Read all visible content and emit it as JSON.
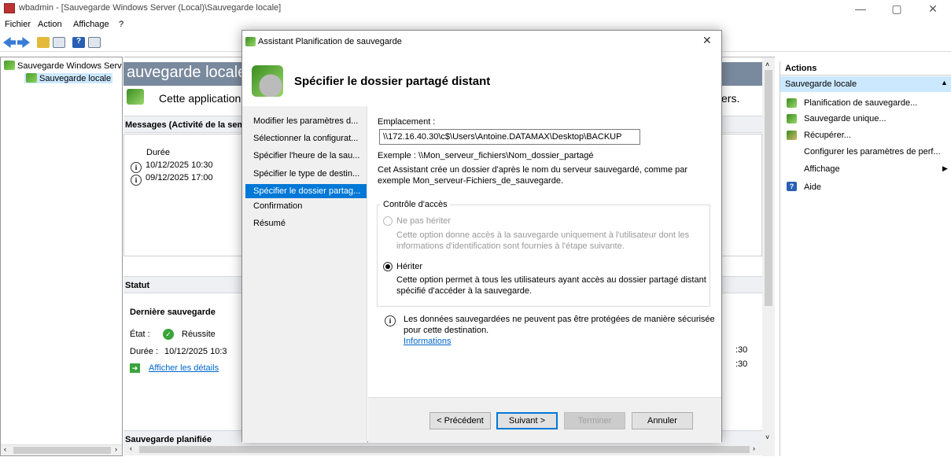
{
  "window": {
    "title": "wbadmin - [Sauvegarde Windows Server (Local)\\Sauvegarde locale]",
    "minimize": "—",
    "maximize": "▢",
    "close": "✕"
  },
  "menu": [
    "Fichier",
    "Action",
    "Affichage",
    "?"
  ],
  "tree": {
    "root": "Sauvegarde Windows Serv",
    "child": "Sauvegarde locale"
  },
  "main": {
    "header": "auvegarde locale",
    "intro": "Cette application",
    "intro_tail": "ers.",
    "messages_title": "Messages (Activité de la sem",
    "col_duree": "Durée",
    "messages": [
      "10/12/2025 10:30",
      "09/12/2025 17:00"
    ],
    "statut_title": "Statut",
    "last_backup_title": "Dernière sauvegarde",
    "etat_label": "État :",
    "etat_value": "Réussite",
    "duree_label": "Durée :",
    "duree_value": "10/12/2025 10:3",
    "details_link": "Afficher les détails",
    "right_times": [
      ":30",
      ":30"
    ],
    "planned_title": "Sauvegarde planifiée"
  },
  "actions": {
    "header": "Actions",
    "section": "Sauvegarde locale",
    "items": [
      "Planification de sauvegarde...",
      "Sauvegarde unique...",
      "Récupérer...",
      "Configurer les paramètres de perf...",
      "Affichage",
      "Aide"
    ]
  },
  "dialog": {
    "title": "Assistant Planification de sauvegarde",
    "close": "✕",
    "heading": "Spécifier le dossier partagé distant",
    "steps": [
      "Modifier les paramètres d...",
      "Sélectionner la configurat...",
      "Spécifier l'heure de la sau...",
      "Spécifier le type de destin...",
      "Spécifier le dossier partag...",
      "Confirmation",
      "Résumé"
    ],
    "location_label": "Emplacement :",
    "location_value": "\\\\172.16.40.30\\c$\\Users\\Antoine.DATAMAX\\Desktop\\BACKUP",
    "example": "Exemple : \\\\Mon_serveur_fichiers\\Nom_dossier_partagé",
    "desc_line1": "Cet Assistant crée un dossier d'après le nom du serveur sauvegardé, comme par",
    "desc_line2": "exemple Mon_serveur-Fichiers_de_sauvegarde.",
    "access_group": "Contrôle d'accès",
    "option1_label": "Ne pas hériter",
    "option1_desc1": "Cette option donne accès à la sauvegarde uniquement à l'utilisateur dont les",
    "option1_desc2": "informations d'identification sont fournies à l'étape suivante.",
    "option2_label": "Hériter",
    "option2_desc1": "Cette option permet à tous les utilisateurs ayant accès au dossier partagé distant",
    "option2_desc2": "spécifié d'accéder à la sauvegarde.",
    "warning1": "Les données sauvegardées ne peuvent pas être protégées de manière sécurisée",
    "warning2": "pour cette destination.",
    "info_link": "Informations",
    "btn_prev": "< Précédent",
    "btn_next": "Suivant >",
    "btn_finish": "Terminer",
    "btn_cancel": "Annuler"
  }
}
